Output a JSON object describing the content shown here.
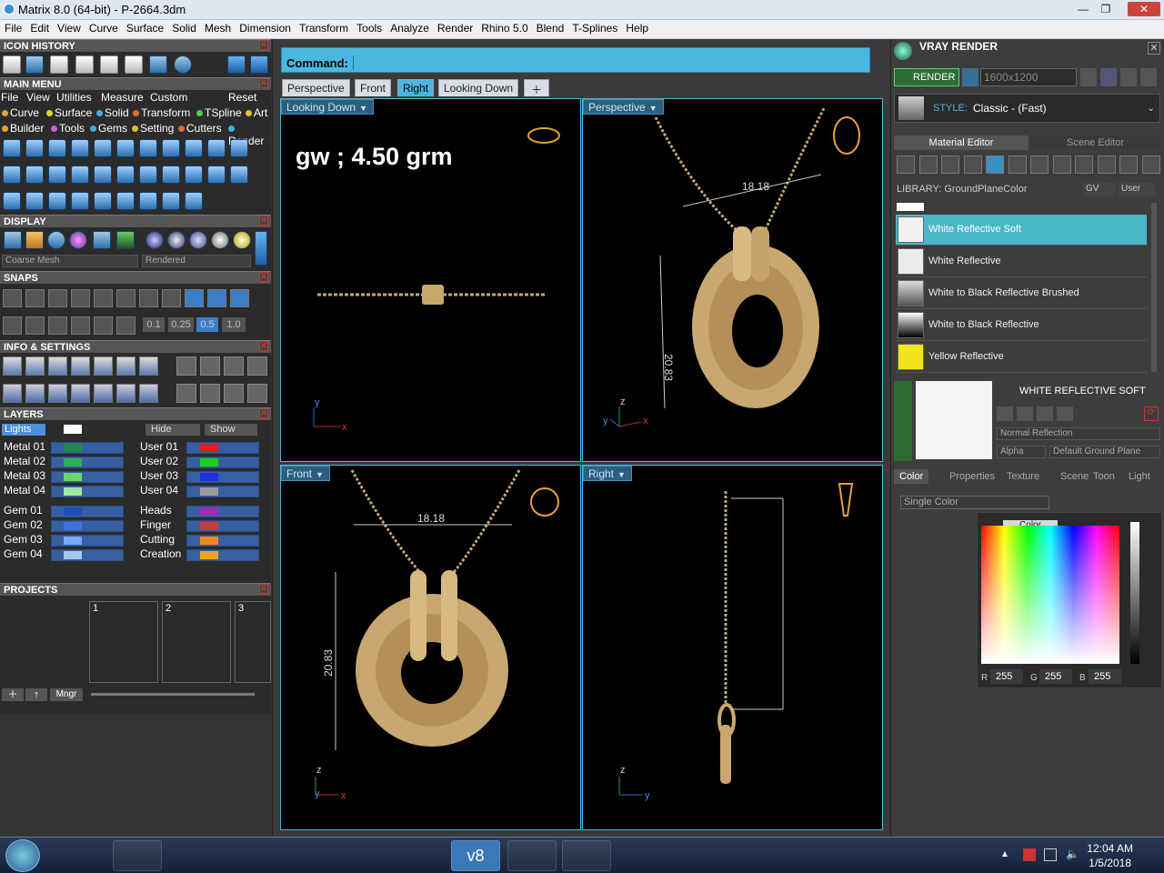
{
  "window": {
    "title": "Matrix 8.0 (64-bit) - P-2664.3dm",
    "min": "—",
    "max": "❐",
    "close": "✕"
  },
  "menu": [
    "File",
    "Edit",
    "View",
    "Curve",
    "Surface",
    "Solid",
    "Mesh",
    "Dimension",
    "Transform",
    "Tools",
    "Analyze",
    "Render",
    "Rhino 5.0",
    "Blend",
    "T-Splines",
    "Help"
  ],
  "left": {
    "icon_history": "ICON HISTORY",
    "main_menu": {
      "title": "MAIN MENU",
      "row1": [
        "File",
        "View",
        "Utilities",
        "Measure",
        "Custom"
      ],
      "reset": "Reset",
      "row2": [
        {
          "label": "Curve",
          "color": "#e3a52c"
        },
        {
          "label": "Surface",
          "color": "#d8d830"
        },
        {
          "label": "Solid",
          "color": "#3fb0e0"
        },
        {
          "label": "Transform",
          "color": "#e06a2c"
        },
        {
          "label": "TSpline",
          "color": "#4fcf4f"
        },
        {
          "label": "Art",
          "color": "#e6c12c"
        }
      ],
      "row3": [
        {
          "label": "Builder",
          "color": "#e3a52c"
        },
        {
          "label": "Tools",
          "color": "#c860d8"
        },
        {
          "label": "Gems",
          "color": "#3fb0e0"
        },
        {
          "label": "Setting",
          "color": "#e0c02c"
        },
        {
          "label": "Cutters",
          "color": "#e06a2c"
        },
        {
          "label": "Render",
          "color": "#3fb0e0"
        }
      ]
    },
    "display": {
      "title": "DISPLAY",
      "mesh": "Coarse Mesh",
      "mode": "Rendered"
    },
    "snaps": {
      "title": "SNAPS",
      "values": [
        "0.1",
        "0.25",
        "0.5",
        "1.0"
      ]
    },
    "info": "INFO & SETTINGS",
    "layers": {
      "title": "LAYERS",
      "lights": "Lights",
      "hide": "Hide",
      "show": "Show",
      "left": [
        {
          "name": "Metal 01",
          "color": "#1f8a4c"
        },
        {
          "name": "Metal 02",
          "color": "#2eae5e"
        },
        {
          "name": "Metal 03",
          "color": "#6bd66b"
        },
        {
          "name": "Metal 04",
          "color": "#9ee8a0"
        },
        {
          "name": "Gem 01",
          "color": "#1f4fb8"
        },
        {
          "name": "Gem 02",
          "color": "#3d74dd"
        },
        {
          "name": "Gem 03",
          "color": "#7aa8f0"
        },
        {
          "name": "Gem 04",
          "color": "#a9c6f5"
        }
      ],
      "right": [
        {
          "name": "User 01",
          "color": "#e21f1f"
        },
        {
          "name": "User 02",
          "color": "#1fd11f"
        },
        {
          "name": "User 03",
          "color": "#1f2fe2"
        },
        {
          "name": "User 04",
          "color": "#9a9a9a"
        },
        {
          "name": "Heads",
          "color": "#9a2fb8"
        },
        {
          "name": "Finger",
          "color": "#c83c3c"
        },
        {
          "name": "Cutting",
          "color": "#e88a1f"
        },
        {
          "name": "Creation",
          "color": "#f0a21f"
        }
      ]
    },
    "projects": {
      "title": "PROJECTS",
      "slots": [
        "1",
        "2",
        "3"
      ],
      "mngr": "Mngr"
    }
  },
  "command": {
    "label": "Command:",
    "value": ""
  },
  "view_tabs": [
    "Perspective",
    "Front",
    "Right",
    "Looking Down"
  ],
  "active_tab": "Right",
  "viewports": {
    "tl": {
      "label": "Looking Down",
      "overlay": "gw ; 4.50 grm",
      "axis_y": "y",
      "axis_x": "x"
    },
    "tr": {
      "label": "Perspective",
      "dim_w": "18.18",
      "dim_h": "20.83",
      "axis_z": "z",
      "axis_y": "y",
      "axis_x": "x"
    },
    "bl": {
      "label": "Front",
      "dim_w": "18.18",
      "dim_h": "20.83",
      "axis_z": "z",
      "axis_y": "y",
      "axis_x": "x"
    },
    "br": {
      "label": "Right",
      "axis_z": "z",
      "axis_y": "y"
    }
  },
  "right": {
    "title": "VRAY RENDER",
    "render": "RENDER",
    "resolution": "1600x1200",
    "style_label": "STYLE:",
    "style": "Classic - (Fast)",
    "tabs": [
      "Material Editor",
      "Scene Editor"
    ],
    "library": "LIBRARY: GroundPlaneColor",
    "gv": "GV",
    "user": "User",
    "materials": [
      {
        "name": "White Reflective Soft",
        "selected": true
      },
      {
        "name": "White Reflective",
        "selected": false
      },
      {
        "name": "White to Black Reflective Brushed",
        "selected": false
      },
      {
        "name": "White to Black Reflective",
        "selected": false
      },
      {
        "name": "Yellow Reflective",
        "selected": false
      }
    ],
    "mat_title": "WHITE REFLECTIVE SOFT",
    "reflection": "Normal Reflection",
    "alpha": "Alpha",
    "ground": "Default Ground Plane",
    "prop_tabs": [
      "Color",
      "Properties",
      "Texture",
      "Scene",
      "Toon",
      "Light"
    ],
    "color_mode": "Single Color",
    "color_label": "Color",
    "rgb": {
      "r_label": "R",
      "r": "255",
      "g_label": "G",
      "g": "255",
      "b_label": "B",
      "b": "255"
    }
  },
  "taskbar": {
    "time": "12:04 AM",
    "date": "1/5/2018",
    "app_label": "v8"
  }
}
